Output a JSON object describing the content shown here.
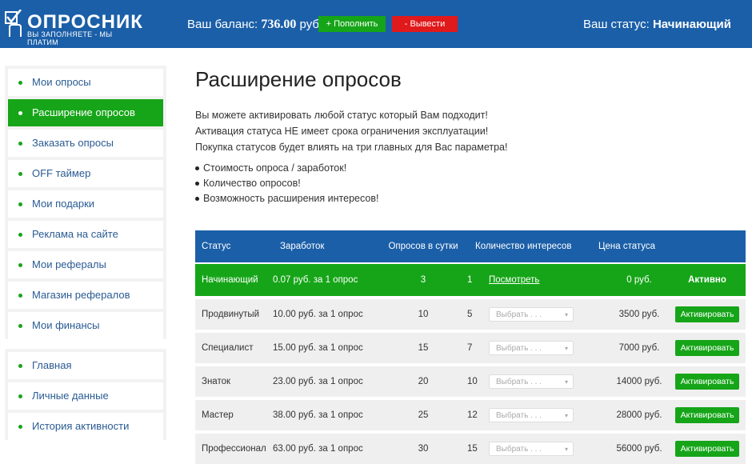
{
  "header": {
    "logo_title": "ОПРОСНИК",
    "logo_subtitle": "ВЫ ЗАПОЛНЯЕТЕ - МЫ ПЛАТИМ",
    "balance_label": "Ваш баланс:",
    "balance_value": "736.00",
    "balance_currency": "руб.",
    "topup_label": "+ Пополнить",
    "withdraw_label": "- Вывести",
    "status_label": "Ваш статус:",
    "status_value": "Начинающий",
    "colors": {
      "header_bg": "#1b5fa8",
      "green": "#16a518",
      "red": "#e0191b"
    }
  },
  "sidebar": {
    "group1": [
      {
        "label": "Мои опросы",
        "active": false
      },
      {
        "label": "Расширение опросов",
        "active": true
      },
      {
        "label": "Заказать опросы",
        "active": false
      },
      {
        "label": "OFF таймер",
        "active": false
      },
      {
        "label": "Мои подарки",
        "active": false
      },
      {
        "label": "Реклама на сайте",
        "active": false
      },
      {
        "label": "Мои рефералы",
        "active": false
      },
      {
        "label": "Магазин рефералов",
        "active": false
      },
      {
        "label": "Мои финансы",
        "active": false
      }
    ],
    "group2": [
      {
        "label": "Главная"
      },
      {
        "label": "Личные данные"
      },
      {
        "label": "История активности"
      }
    ]
  },
  "main": {
    "title": "Расширение опросов",
    "intro": [
      "Вы можете активировать любой статус который Вам подходит!",
      "Активация статуса НЕ имеет срока ограничения эксплуатации!",
      "Покупка статусов будет влиять на три главных для Вас параметра!"
    ],
    "bullets": [
      "Стоимость опроса / заработок!",
      "Количество опросов!",
      "Возможность расширения интересов!"
    ]
  },
  "table": {
    "headers": {
      "status": "Статус",
      "earnings": "Заработок",
      "per_day": "Опросов в сутки",
      "interests": "Количество интересов",
      "price": "Цена статуса"
    },
    "current_row": {
      "status": "Начинающий",
      "earnings": "0.07 руб. за 1 опрос",
      "per_day": "3",
      "interests": "1",
      "view_link": "Посмотреть",
      "price": "0 руб.",
      "state": "Активно"
    },
    "select_placeholder": "Выбрать . . .",
    "activate_label": "Активировать",
    "rows": [
      {
        "status": "Продвинутый",
        "earnings": "10.00 руб. за 1 опрос",
        "per_day": "10",
        "interests": "5",
        "price": "3500 руб."
      },
      {
        "status": "Специалист",
        "earnings": "15.00 руб. за 1 опрос",
        "per_day": "15",
        "interests": "7",
        "price": "7000 руб."
      },
      {
        "status": "Знаток",
        "earnings": "23.00 руб. за 1 опрос",
        "per_day": "20",
        "interests": "10",
        "price": "14000 руб."
      },
      {
        "status": "Мастер",
        "earnings": "38.00 руб. за 1 опрос",
        "per_day": "25",
        "interests": "12",
        "price": "28000 руб."
      },
      {
        "status": "Профессионал",
        "earnings": "63.00 руб. за 1 опрос",
        "per_day": "30",
        "interests": "15",
        "price": "56000 руб."
      }
    ]
  }
}
